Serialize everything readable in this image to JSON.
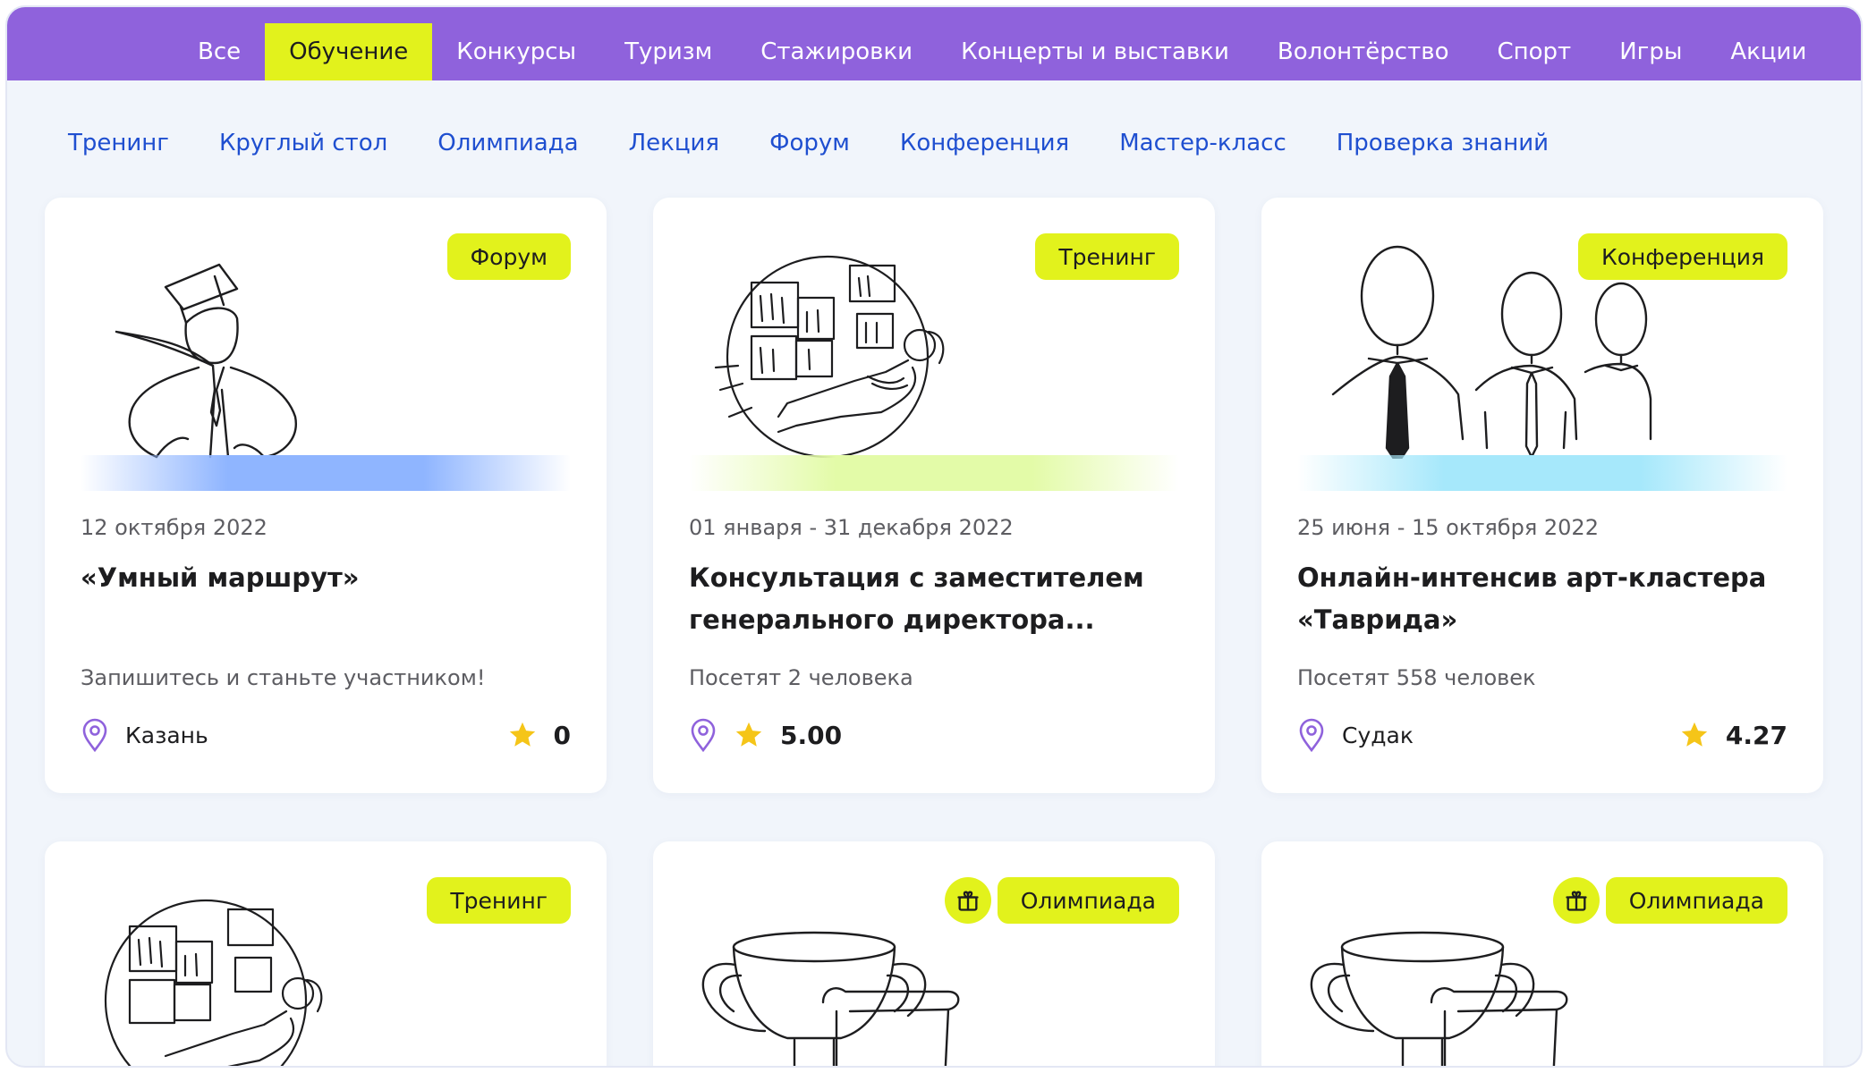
{
  "categories": {
    "items": [
      "Все",
      "Обучение",
      "Конкурсы",
      "Туризм",
      "Стажировки",
      "Концерты и выставки",
      "Волонтёрство",
      "Спорт",
      "Игры",
      "Акции"
    ],
    "active": "Обучение"
  },
  "subcategories": [
    "Тренинг",
    "Круглый стол",
    "Олимпиада",
    "Лекция",
    "Форум",
    "Конференция",
    "Мастер-класс",
    "Проверка знаний"
  ],
  "colors": {
    "header": "#8f62dc",
    "accent": "#e2f21c",
    "link": "#1f4fd0",
    "band_blue": "#8fb5ff",
    "band_green": "#e3fba8",
    "band_cyan": "#a6e8fb",
    "star": "#f5c518",
    "pin": "#8f62dc"
  },
  "cards": [
    {
      "tag": "Форум",
      "date": "12 октября 2022",
      "title": "«Умный маршрут»",
      "description": "Запишитесь и станьте участником!",
      "city": "Казань",
      "rating": "0",
      "illustration": "graduate-icon"
    },
    {
      "tag": "Тренинг",
      "date": "01 января - 31 декабря 2022",
      "title": "Консультация с заместителем генерального директора...",
      "description": "Посетят 2 человека",
      "city": "",
      "rating": "5.00",
      "illustration": "reading-window-icon"
    },
    {
      "tag": "Конференция",
      "date": "25 июня - 15 октября 2022",
      "title": "Онлайн-интенсив арт-кластера «Таврида»",
      "description": "Посетят 558 человек",
      "city": "Судак",
      "rating": "4.27",
      "illustration": "people-group-icon"
    },
    {
      "tag": "Тренинг",
      "illustration": "reading-window-icon"
    },
    {
      "tag": "Олимпиада",
      "gift_icon": "gift-icon",
      "illustration": "trophy-scroll-icon"
    },
    {
      "tag": "Олимпиада",
      "gift_icon": "gift-icon",
      "illustration": "trophy-scroll-icon"
    }
  ]
}
